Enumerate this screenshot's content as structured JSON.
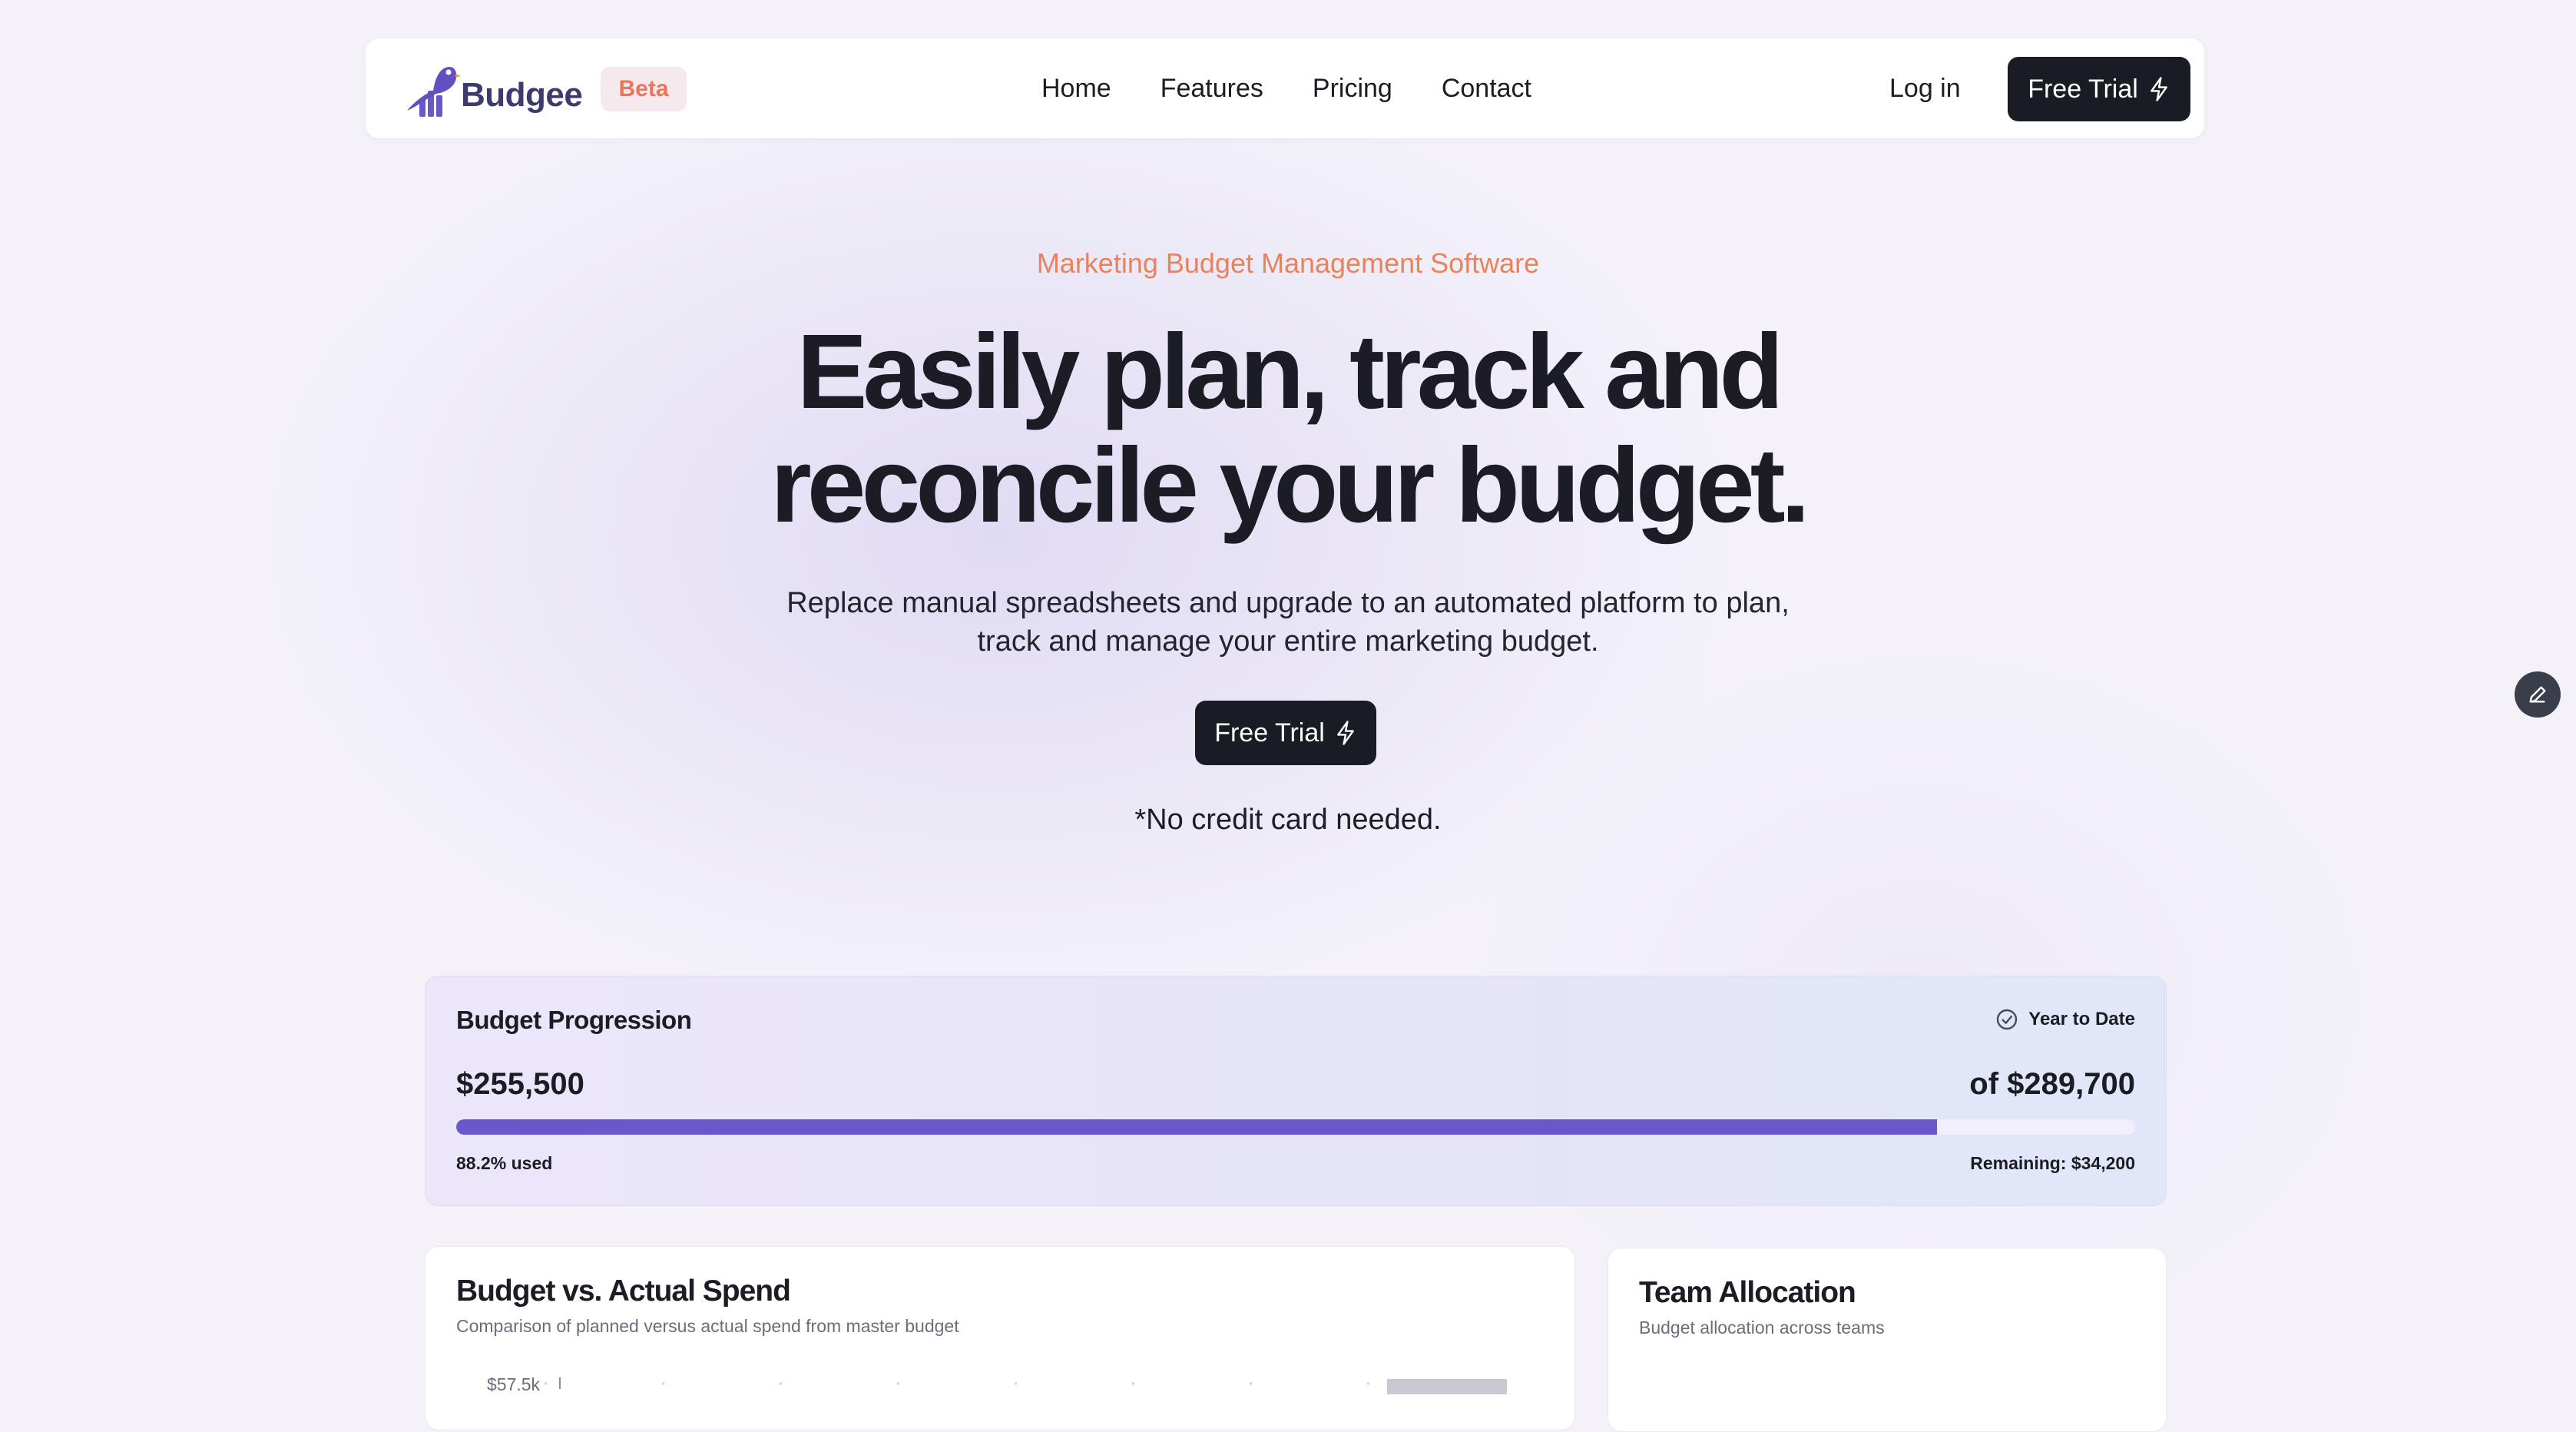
{
  "nav": {
    "brand": "Budgee",
    "badge": "Beta",
    "links": [
      "Home",
      "Features",
      "Pricing",
      "Contact"
    ],
    "login": "Log in",
    "cta": "Free Trial"
  },
  "hero": {
    "eyebrow": "Marketing Budget Management Software",
    "headline_line1": "Easily plan, track and",
    "headline_line2": "reconcile your budget.",
    "subtext_line1": "Replace manual spreadsheets and upgrade to an automated platform to plan,",
    "subtext_line2": "track and manage your entire marketing budget.",
    "cta": "Free Trial",
    "note": "*No credit card needed."
  },
  "budget_progression": {
    "title": "Budget Progression",
    "period": "Year to Date",
    "spent": "$255,500",
    "total": "of $289,700",
    "used_fraction": 0.882,
    "used_label": "88.2% used",
    "remaining_label": "Remaining: $34,200"
  },
  "budget_vs_actual": {
    "title": "Budget vs. Actual Spend",
    "subtitle": "Comparison of planned versus actual spend from master budget",
    "top_tick": "$57.5k"
  },
  "team_allocation": {
    "title": "Team Allocation",
    "subtitle": "Budget allocation across teams"
  },
  "colors": {
    "accent": "#6a57c9",
    "eyebrow": "#e8825f",
    "badge_text": "#e8765b",
    "dark_button": "#1a1c24"
  },
  "icons": {
    "logo": "bird-logo-icon",
    "cta": "lightning-bolt-icon",
    "period": "check-circle-icon",
    "fab": "pencil-icon"
  }
}
